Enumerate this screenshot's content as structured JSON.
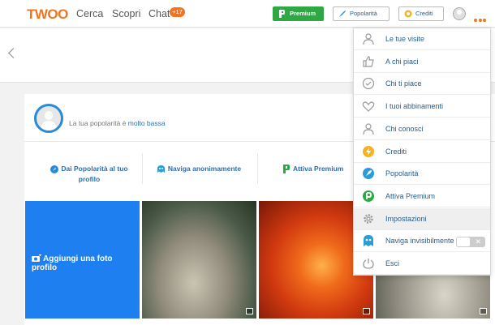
{
  "header": {
    "logo": "TWOO",
    "nav": [
      "Cerca",
      "Scopri",
      "Chat"
    ],
    "chat_badge": "+17",
    "premium_label": "Premium",
    "popularity_label": "Popolarità",
    "credits_label": "Crediti"
  },
  "profile": {
    "popularity_prefix": "La tua popolarità è ",
    "popularity_level": "molto bassa"
  },
  "actions": {
    "boost_line1": "Dai Popolarità al tuo",
    "boost_line2": "profilo",
    "anon": "Naviga anonimamente",
    "premium": "Attiva Premium"
  },
  "tiles": {
    "add_photo": "Aggiungi una foto profilo"
  },
  "menu": {
    "items": [
      {
        "label": "Le tue visite",
        "icon": "visitors-icon"
      },
      {
        "label": "A chi piaci",
        "icon": "thumbs-up-icon"
      },
      {
        "label": "Chi ti piace",
        "icon": "check-circle-icon"
      },
      {
        "label": "I tuoi abbinamenti",
        "icon": "heart-icon"
      },
      {
        "label": "Chi conosci",
        "icon": "people-icon"
      },
      {
        "label": "Crediti",
        "icon": "lightning-icon"
      },
      {
        "label": "Popolarità",
        "icon": "rocket-icon"
      },
      {
        "label": "Attiva Premium",
        "icon": "premium-p-icon"
      },
      {
        "label": "Impostazioni",
        "icon": "gear-icon"
      },
      {
        "label": "Naviga invisibilmente",
        "icon": "ghost-icon"
      },
      {
        "label": "Esci",
        "icon": "power-icon"
      }
    ],
    "active_index": 8,
    "toggle_symbol": "✕"
  },
  "colors": {
    "brand": "#f2741e",
    "premium_green": "#2da843",
    "link_blue": "#2b6fb0",
    "tile_blue": "#1d7ff0"
  }
}
